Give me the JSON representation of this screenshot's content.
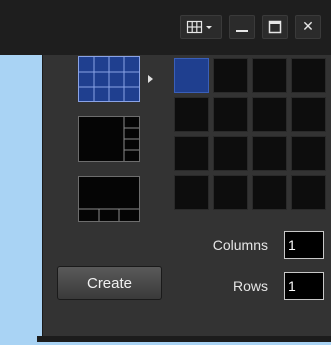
{
  "colors": {
    "desktop": "#a9d3f4",
    "titlebar": "#1e1e1e",
    "panel": "#333333",
    "accent": "#1f3f8f",
    "cell": "#0d0d0d"
  },
  "titlebar": {
    "layout_icon": "grid-layout-icon",
    "layout_dropdown_icon": "caret-down-icon",
    "minimize": "—",
    "maximize": "□",
    "close": "✕"
  },
  "presets": [
    {
      "name": "grid-3x3",
      "selected": true
    },
    {
      "name": "one-large-plus-sidebar",
      "selected": false
    },
    {
      "name": "one-large-plus-bottom-row",
      "selected": false
    }
  ],
  "grid": {
    "columns_total": 4,
    "rows_total": 4,
    "selected_columns": 1,
    "selected_rows": 1
  },
  "form": {
    "columns_label": "Columns",
    "columns_value": "1",
    "rows_label": "Rows",
    "rows_value": "1",
    "create_label": "Create"
  }
}
